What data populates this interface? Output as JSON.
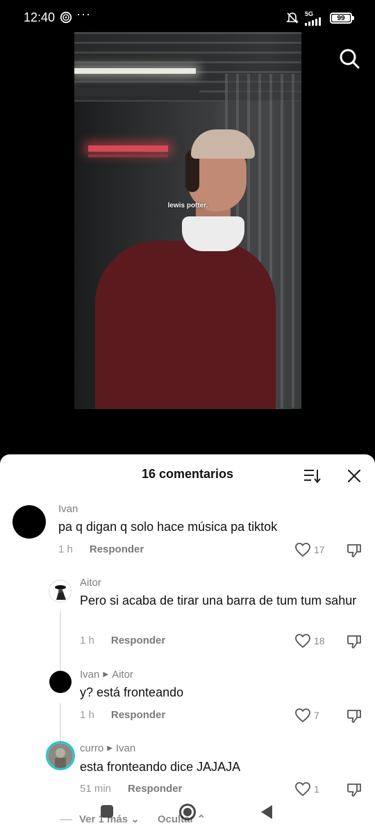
{
  "status_bar": {
    "time": "12:40",
    "dots": "···",
    "network": "5G",
    "battery": "99",
    "battery_level_percent": 99
  },
  "video": {
    "caption": "lewis potter."
  },
  "comments_panel": {
    "title": "16 comentarios",
    "comments": [
      {
        "user": "Ivan",
        "text": "pa q digan q solo hace música pa tiktok",
        "time": "1 h",
        "reply_label": "Responder",
        "likes": "17"
      },
      {
        "user": "Aitor",
        "text": "Pero si acaba de tirar una barra de tum tum sahur",
        "time": "1 h",
        "reply_label": "Responder",
        "likes": "18"
      },
      {
        "user": "Ivan",
        "reply_to": "Aitor",
        "text": "y? está fronteando",
        "time": "1 h",
        "reply_label": "Responder",
        "likes": "7"
      },
      {
        "user": "curro",
        "reply_to": "Ivan",
        "text": "esta fronteando dice JAJAJA",
        "time": "51 min",
        "reply_label": "Responder",
        "likes": "1"
      }
    ],
    "view_more": "Ver 1 más",
    "hide": "Ocultar"
  },
  "icons": {
    "status": [
      "wifi-icon",
      "silent-icon",
      "signal-icon",
      "battery-icon"
    ],
    "panel": [
      "sort-icon",
      "close-icon",
      "heart-icon",
      "dislike-icon"
    ],
    "video": [
      "search-icon"
    ]
  }
}
